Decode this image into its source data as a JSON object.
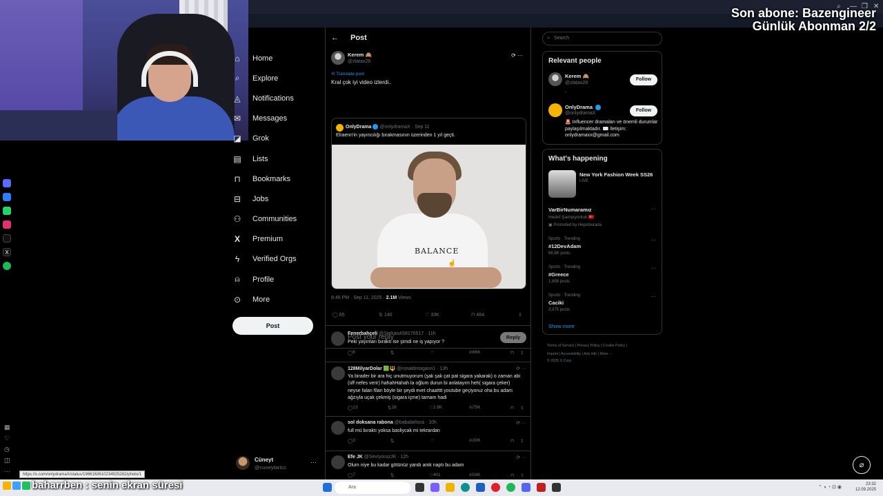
{
  "overlay": {
    "line1": "Son abone: Bazengineer",
    "line2": "Günlük Abonman 2/2"
  },
  "nav": {
    "items": [
      {
        "label": "Home",
        "icon": "home-icon"
      },
      {
        "label": "Explore",
        "icon": "search-icon"
      },
      {
        "label": "Notifications",
        "icon": "bell-icon"
      },
      {
        "label": "Messages",
        "icon": "envelope-icon"
      },
      {
        "label": "Grok",
        "icon": "grok-icon"
      },
      {
        "label": "Lists",
        "icon": "list-icon"
      },
      {
        "label": "Bookmarks",
        "icon": "bookmark-icon"
      },
      {
        "label": "Jobs",
        "icon": "briefcase-icon"
      },
      {
        "label": "Communities",
        "icon": "people-icon"
      },
      {
        "label": "Premium",
        "icon": "x-logo-icon"
      },
      {
        "label": "Verified Orgs",
        "icon": "lightning-icon"
      },
      {
        "label": "Profile",
        "icon": "person-icon"
      },
      {
        "label": "More",
        "icon": "more-circle-icon"
      }
    ],
    "post_button": "Post",
    "account": {
      "name": "Cüneyt",
      "handle": "@cuneytartcc",
      "more": "···"
    }
  },
  "header": {
    "back": "←",
    "title": "Post"
  },
  "main_post": {
    "name": "Kerem",
    "handle": "@zlatax28",
    "translate": "Translate post",
    "text": "Kral çok iyi video izlerdi..",
    "icons": "⟳ ···",
    "quote": {
      "name": "OnlyDrama",
      "meta": "@onlydramaX · Sep 11",
      "text": "Elraenn'in yayıncılığı bırakmasının üzerinden 1 yıl geçti.",
      "image_text": "BALANCE"
    },
    "date_time": "8:46 PM · Sep 11, 2025 · ",
    "views_count": "2.1M",
    "views_label": " Views",
    "stats": {
      "replies": "65",
      "reposts": "140",
      "likes": "33K",
      "bookmarks": "464"
    }
  },
  "reply_box": {
    "placeholder": "Post your reply",
    "button": "Reply"
  },
  "replies": [
    {
      "name": "Fenerbahçeli",
      "meta": "@SerkanA58176517 · 11h",
      "text": "Peki yayınları bıraktı ise şimdi ne iş yapıyor ?",
      "replies": "6",
      "reposts": "",
      "likes": "",
      "views": "66K"
    },
    {
      "name": "128MilyarDolar 🟩🔱",
      "meta": "@ronaldreagann1 · 13h",
      "text": "Ya birader bir ara hiç unutmuyorum (şak şak çat pat sigara yakarak) o zaman abi (üff nefes verir) hahahHahah la oğlum durun bi anlatayım heh( sigara çeker) neyse falan filan böyle bir şeydi evet chaatttt youtube geçiyoruz oha bu adam ağzıyla uçak çekmiş (sigara içme) tamam hadi",
      "replies": "13",
      "reposts": "28",
      "likes": "2.8K",
      "views": "75K"
    },
    {
      "name": "sol doksana rabona",
      "meta": "@babalarloca · 10h",
      "text": "full mü bıraktı yoksa basliycak mi tekrardan",
      "replies": "3",
      "reposts": "",
      "likes": "",
      "views": "30K"
    },
    {
      "name": "Efe JK",
      "meta": "@SevIyoruzJK · 12h",
      "text": "Olum niye bu kadar götünüz yandı amk naptı bu adam",
      "replies": "7",
      "reposts": "",
      "likes": "401",
      "views": "54K"
    }
  ],
  "search": {
    "placeholder": "Search"
  },
  "relevant": {
    "title": "Relevant people",
    "people": [
      {
        "name": "Kerem",
        "handle": "@zlatax28",
        "bio": ".",
        "follow": "Follow"
      },
      {
        "name": "OnlyDrama",
        "handle": "@onlydramaX",
        "bio": "🚨 Influencer dramaları ve önemli durumlar paylaşılmaktadır. ✉️ İletişim: onlydramaxx@gmail.com",
        "follow": "Follow"
      }
    ]
  },
  "happening": {
    "title": "What's happening",
    "featured": {
      "title": "New York Fashion Week SS26",
      "sub": "LIVE"
    },
    "trends": [
      {
        "category": "",
        "title": "VarBirNumaramız",
        "sub": "Hedef Şampiyonluk 🇹🇷",
        "extra": "Promoted by Hepsiburada"
      },
      {
        "category": "Sports · Trending",
        "title": "#12DevAdam",
        "sub": "68.8K posts",
        "extra": ""
      },
      {
        "category": "Sports · Trending",
        "title": "#Greece",
        "sub": "1,858 posts",
        "extra": ""
      },
      {
        "category": "Sports · Trending",
        "title": "Caciki",
        "sub": "3,075 posts",
        "extra": ""
      }
    ],
    "show_more": "Show more"
  },
  "footer": {
    "line1": "Terms of Service  |  Privacy Policy  |  Cookie Policy  |",
    "line2": "Imprint  |  Accessibility  |  Ads info  |  More ···",
    "line3": "© 2025 X Corp."
  },
  "status_url": "https://x.com/onlydramaX/status/1966163610234925282/photo/1",
  "chat": {
    "user": "baharrben",
    "message": " : senin ekran süresi"
  },
  "taskbar": {
    "search": "Ara",
    "time": "23:32",
    "date": "12.09.2025"
  },
  "colors": {
    "accent": "#1d9bf0",
    "bg": "#000000",
    "border": "#2f3336",
    "muted": "#71767b"
  }
}
